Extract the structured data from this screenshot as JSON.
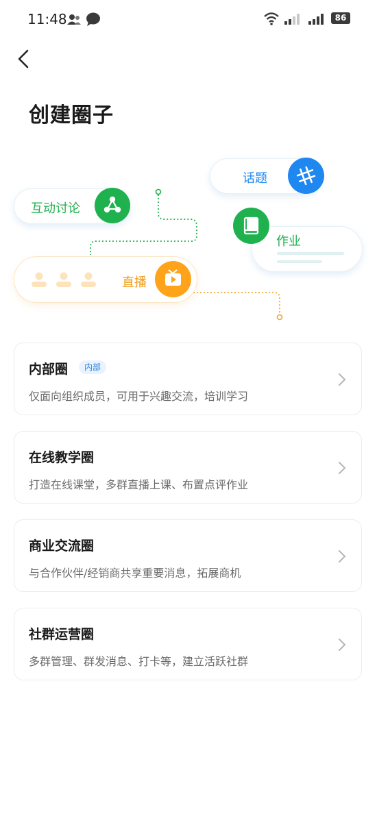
{
  "status_bar": {
    "time": "11:48",
    "battery": "86"
  },
  "header": {
    "title": "创建圈子"
  },
  "illustration": {
    "topic_label": "话题",
    "discussion_label": "互动讨论",
    "homework_label": "作业",
    "live_label": "直播"
  },
  "colors": {
    "green": "#1fb14e",
    "blue": "#1e88f0",
    "orange": "#ffa31a",
    "badge_blue": "#2a82e4"
  },
  "options": [
    {
      "title": "内部圈",
      "badge": "内部",
      "desc": "仅面向组织成员，可用于兴趣交流，培训学习"
    },
    {
      "title": "在线教学圈",
      "badge": "",
      "desc": "打造在线课堂，多群直播上课、布置点评作业"
    },
    {
      "title": "商业交流圈",
      "badge": "",
      "desc": "与合作伙伴/经销商共享重要消息，拓展商机"
    },
    {
      "title": "社群运营圈",
      "badge": "",
      "desc": "多群管理、群发消息、打卡等，建立活跃社群"
    }
  ]
}
